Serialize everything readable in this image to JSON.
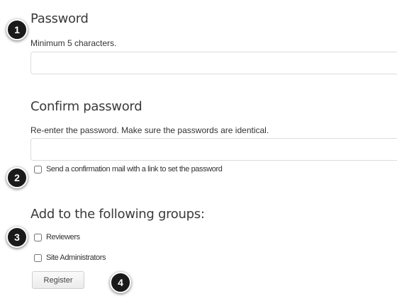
{
  "password": {
    "heading": "Password",
    "help": "Minimum 5 characters.",
    "value": ""
  },
  "confirm": {
    "heading": "Confirm password",
    "help": "Re-enter the password. Make sure the passwords are identical.",
    "value": ""
  },
  "send_mail": {
    "label": "Send a confirmation mail with a link to set the password",
    "checked": false
  },
  "groups": {
    "heading": "Add to the following groups:",
    "items": [
      {
        "label": "Reviewers",
        "checked": false
      },
      {
        "label": "Site Administrators",
        "checked": false
      }
    ]
  },
  "register_label": "Register",
  "markers": [
    "1",
    "2",
    "3",
    "4"
  ]
}
